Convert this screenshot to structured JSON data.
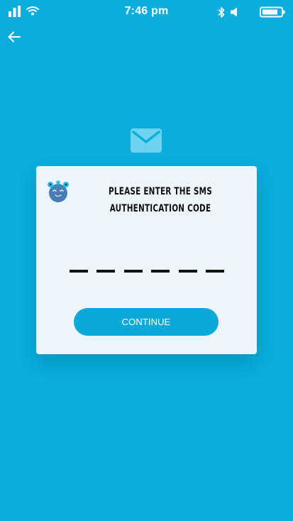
{
  "status_bar": {
    "time": "7:46 pm",
    "icons": [
      "signal-icon",
      "wifi-icon",
      "bluetooth-icon",
      "speaker-icon",
      "battery-icon"
    ]
  },
  "nav": {
    "back_icon": "arrow-left-icon"
  },
  "hero": {
    "icon": "mail-icon"
  },
  "card": {
    "mascot_icon": "mascot-icon",
    "title_line1": "Please enter the SMS",
    "title_line2": "authentication code",
    "code_length": 6,
    "code_value": "",
    "continue_label": "CONTINUE"
  },
  "colors": {
    "background": "#09aedc",
    "card": "#eef6fd",
    "button": "#0aa9da",
    "text_dark": "#111111"
  }
}
